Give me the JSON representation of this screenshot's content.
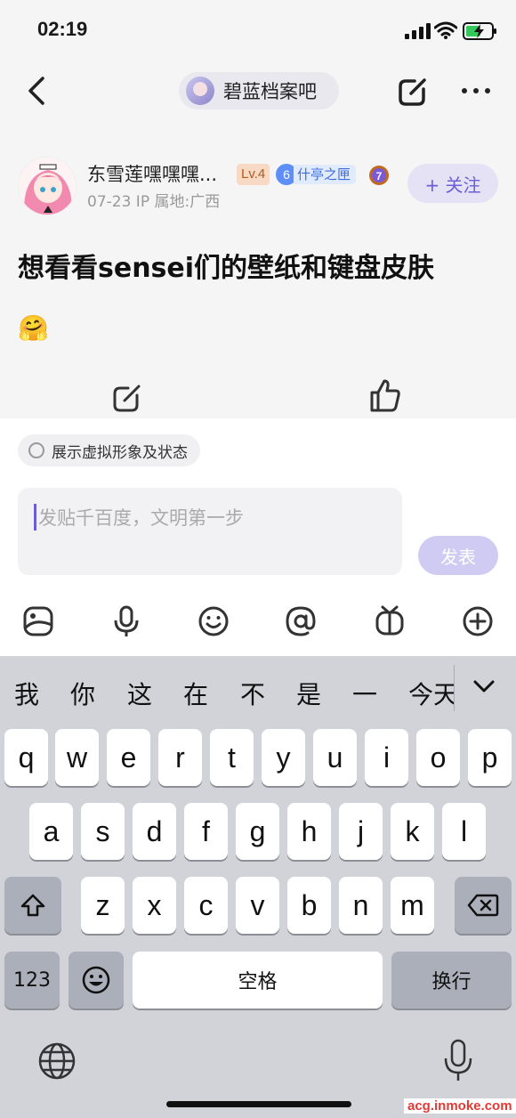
{
  "status": {
    "time": "02:19"
  },
  "nav": {
    "forum_name": "碧蓝档案吧"
  },
  "post": {
    "author": "东雪莲嘿嘿嘿...",
    "level": "Lv.4",
    "rank_number": "6",
    "rank_name": "什亭之匣",
    "medal_number": "7",
    "meta": "07-23   IP 属地:广西",
    "follow_label": "+ 关注",
    "title": "想看看sensei们的壁纸和键盘皮肤",
    "emoji": "🤗"
  },
  "reply": {
    "avatar_toggle_label": "展示虚拟形象及状态",
    "placeholder": "发贴千百度，文明第一步",
    "send_label": "发表"
  },
  "keyboard": {
    "candidates": [
      "我",
      "你",
      "这",
      "在",
      "不",
      "是",
      "一",
      "今天"
    ],
    "row1": [
      "q",
      "w",
      "e",
      "r",
      "t",
      "y",
      "u",
      "i",
      "o",
      "p"
    ],
    "row2": [
      "a",
      "s",
      "d",
      "f",
      "g",
      "h",
      "j",
      "k",
      "l"
    ],
    "row3": [
      "z",
      "x",
      "c",
      "v",
      "b",
      "n",
      "m"
    ],
    "numbers_label": "123",
    "space_label": "空格",
    "return_label": "换行"
  },
  "watermark": "acg.inmoke.com",
  "colors": {
    "accent": "#6a5fd6",
    "send_disabled": "#cfcbf2",
    "keyboard_bg": "#d1d3d9"
  }
}
